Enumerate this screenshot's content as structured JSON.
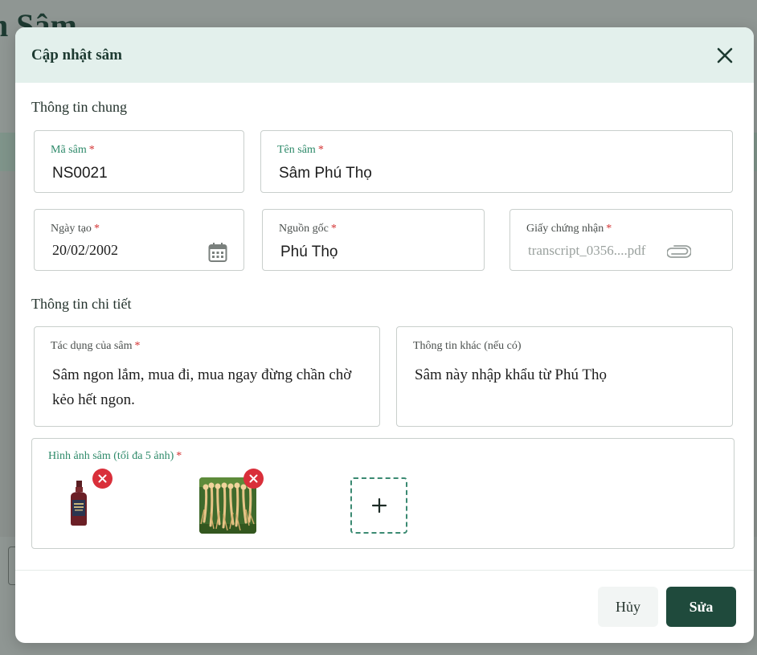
{
  "background": {
    "page_title_fragment": "h Sâm"
  },
  "modal": {
    "title": "Cập nhật sâm",
    "close_icon": "close-icon",
    "general_section": "Thông tin chung",
    "detail_section": "Thông tin chi tiết",
    "fields": {
      "code": {
        "label": "Mã sâm",
        "value": "NS0021"
      },
      "name": {
        "label": "Tên sâm",
        "value": "Sâm Phú Thọ"
      },
      "created_date": {
        "label": "Ngày tạo",
        "value": "20/02/2002",
        "icon": "calendar-icon"
      },
      "origin": {
        "label": "Nguồn gốc",
        "value": "Phú Thọ"
      },
      "certificate": {
        "label": "Giấy chứng nhận",
        "value": "transcript_0356....pdf",
        "icon": "paperclip-icon"
      },
      "effects": {
        "label": "Tác dụng của sâm",
        "value": "Sâm ngon lắm, mua đi, mua ngay đừng chần chờ kẻo hết ngon."
      },
      "other_info": {
        "label": "Thông tin khác (nếu có)",
        "value": "Sâm này nhập khẩu từ Phú Thọ"
      }
    },
    "images": {
      "label": "Hình ảnh sâm (tối đa 5 ảnh)",
      "items": [
        "bottle-image",
        "ginseng-roots-image"
      ],
      "add_icon": "plus-icon"
    },
    "required_mark": "*",
    "buttons": {
      "cancel": "Hủy",
      "save": "Sửa"
    },
    "colors": {
      "header_bg": "#e3f0ec",
      "primary": "#1f4a3c",
      "accent_green": "#2e8a6a",
      "required_red": "#d32f2f"
    }
  }
}
